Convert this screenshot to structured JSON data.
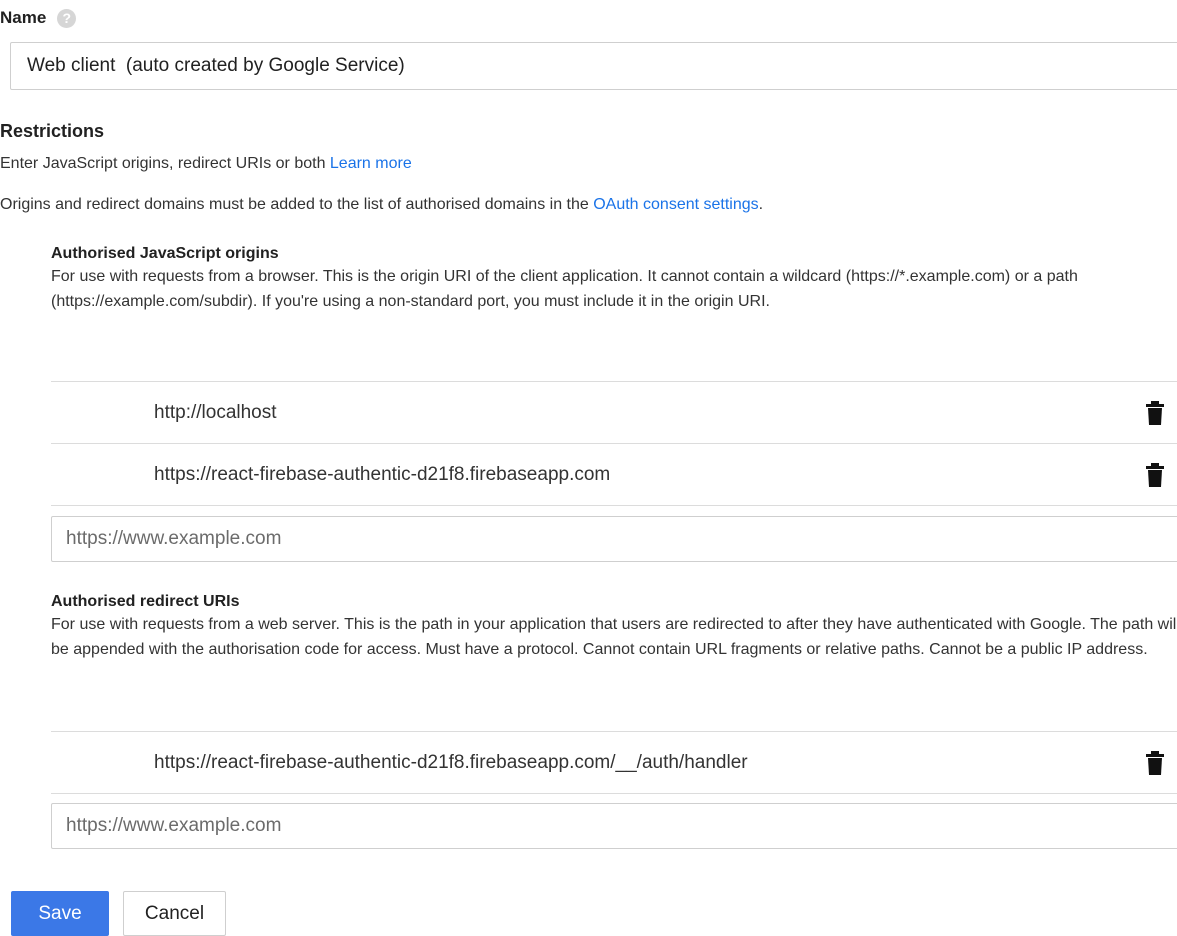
{
  "name_field": {
    "label": "Name",
    "help_icon": "help-icon",
    "value": "Web client  (auto created by Google Service)"
  },
  "restrictions": {
    "title": "Restrictions",
    "intro_text": "Enter JavaScript origins, redirect URIs or both ",
    "learn_more_link": "Learn more",
    "domains_note": "Origins and redirect domains must be added to the list of authorised domains in the ",
    "oauth_link": "OAuth consent settings",
    "domains_note_end": "."
  },
  "js_origins": {
    "title": "Authorised JavaScript origins",
    "description": "For use with requests from a browser. This is the origin URI of the client application. It cannot contain a wildcard (https://*.example.com) or a path (https://example.com/subdir). If you're using a non-standard port, you must include it in the origin URI.",
    "items": [
      {
        "uri": "http://localhost",
        "icon": "trash-icon"
      },
      {
        "uri": "https://react-firebase-authentic-d21f8.firebaseapp.com",
        "icon": "trash-icon"
      }
    ],
    "new_placeholder": "https://www.example.com"
  },
  "redirect_uris": {
    "title": "Authorised redirect URIs",
    "description": "For use with requests from a web server. This is the path in your application that users are redirected to after they have authenticated with Google. The path will be appended with the authorisation code for access. Must have a protocol. Cannot contain URL fragments or relative paths. Cannot be a public IP address.",
    "items": [
      {
        "uri": "https://react-firebase-authentic-d21f8.firebaseapp.com/__/auth/handler",
        "icon": "trash-icon"
      }
    ],
    "new_placeholder": "https://www.example.com"
  },
  "actions": {
    "save_label": "Save",
    "cancel_label": "Cancel"
  },
  "colors": {
    "link": "#1a73e8",
    "primary_button": "#3b78e7"
  }
}
